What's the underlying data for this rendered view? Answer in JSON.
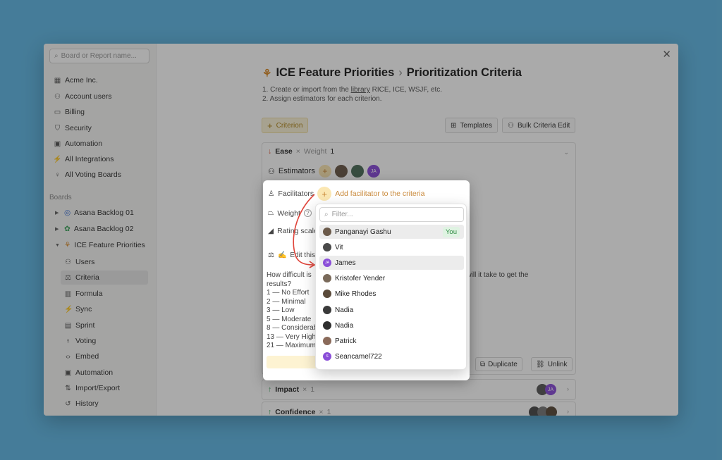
{
  "sidebar": {
    "search_placeholder": "Board or Report name...",
    "items": [
      {
        "label": "Acme Inc.",
        "icon": "building-icon"
      },
      {
        "label": "Account users",
        "icon": "users-icon"
      },
      {
        "label": "Billing",
        "icon": "credit-card-icon"
      },
      {
        "label": "Security",
        "icon": "shield-icon"
      },
      {
        "label": "Automation",
        "icon": "automation-icon"
      },
      {
        "label": "All Integrations",
        "icon": "plug-icon"
      },
      {
        "label": "All Voting Boards",
        "icon": "lightbulb-icon"
      }
    ],
    "boards_label": "Boards",
    "boards": [
      {
        "label": "Asana Backlog 01"
      },
      {
        "label": "Asana Backlog 02"
      },
      {
        "label": "ICE Feature Priorities"
      }
    ],
    "board_sub": [
      {
        "label": "Users",
        "icon": "users-icon"
      },
      {
        "label": "Criteria",
        "icon": "criteria-icon"
      },
      {
        "label": "Formula",
        "icon": "formula-icon"
      },
      {
        "label": "Sync",
        "icon": "sync-icon"
      },
      {
        "label": "Sprint",
        "icon": "calendar-icon"
      },
      {
        "label": "Voting",
        "icon": "lightbulb-icon"
      },
      {
        "label": "Embed",
        "icon": "code-icon"
      },
      {
        "label": "Automation",
        "icon": "automation-icon"
      },
      {
        "label": "Import/Export",
        "icon": "import-icon"
      },
      {
        "label": "History",
        "icon": "history-icon"
      }
    ]
  },
  "header": {
    "board": "ICE Feature Priorities",
    "page": "Prioritization Criteria",
    "step1_pre": "1.  Create or import from the",
    "step1_link": "library",
    "step1_post": "RICE, ICE, WSJF, etc.",
    "step2": "2.  Assign estimators for each criterion."
  },
  "toolbar": {
    "criterion": "Criterion",
    "templates": "Templates",
    "bulk": "Bulk Criteria Edit"
  },
  "criterion": {
    "name": "Ease",
    "weight_label": "Weight",
    "weight_value": "1",
    "estimators_label": "Estimators",
    "right_desc": "ong will it take to get the",
    "edit_label": "Edit this",
    "question": "How difficult is",
    "results": "results?",
    "scale": [
      "1 — No Effort",
      "2 — Minimal",
      "3 — Low",
      "5 — Moderate",
      "8 — Considerab",
      "13 — Very High",
      "21 — Maximum"
    ],
    "duplicate": "Duplicate",
    "unlink": "Unlink"
  },
  "other_criteria": [
    {
      "name": "Impact",
      "weight": "1"
    },
    {
      "name": "Confidence",
      "weight": "1"
    }
  ],
  "facilitators": {
    "label": "Facilitators",
    "add_text": "Add facilitator to the criteria",
    "weight_label": "Weight",
    "rating_label": "Rating scale"
  },
  "dropdown": {
    "filter_placeholder": "Filter...",
    "you_badge": "You",
    "people": [
      {
        "name": "Panganayi Gashu"
      },
      {
        "name": "Vit"
      },
      {
        "name": "James",
        "initials": "JA"
      },
      {
        "name": "Kristofer Yender"
      },
      {
        "name": "Mike Rhodes"
      },
      {
        "name": "Nadia"
      },
      {
        "name": "Nadia"
      },
      {
        "name": "Patrick"
      },
      {
        "name": "Seancamel722",
        "initials": "S"
      }
    ]
  },
  "avatars": {
    "ja": "JA"
  },
  "colors": {
    "accent_orange": "#c9893a",
    "down_arrow": "#e05a3a",
    "up_arrow": "#3aa35a",
    "purple": "#8a4ed8",
    "you_green": "#2e8b42",
    "arrow_red": "#e0443a"
  }
}
